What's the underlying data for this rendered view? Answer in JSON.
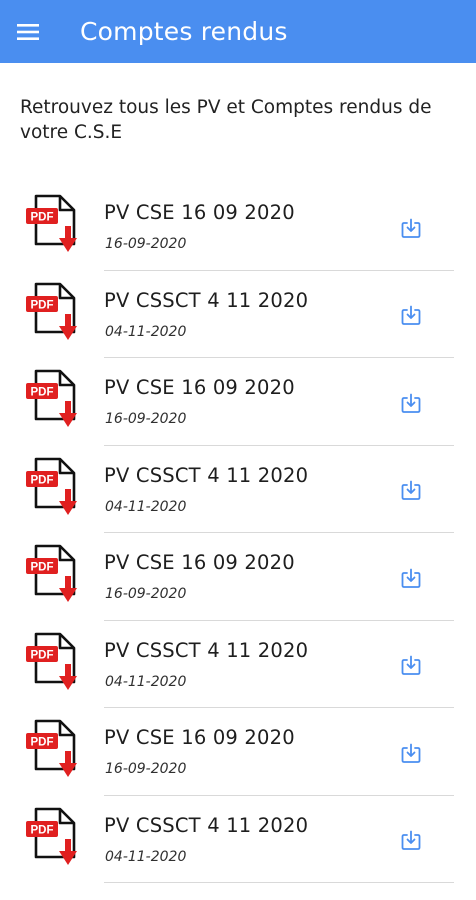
{
  "appbar": {
    "title": "Comptes rendus",
    "menu_icon": "hamburger-menu-icon",
    "color": "#4a8ef0"
  },
  "intro": "Retrouvez tous les PV et Comptes rendus de votre C.S.E",
  "documents": [
    {
      "title": "PV CSE 16 09 2020",
      "date": "16-09-2020",
      "file_icon": "pdf-file-icon",
      "action_icon": "download-icon"
    },
    {
      "title": "PV CSSCT 4 11 2020",
      "date": "04-11-2020",
      "file_icon": "pdf-file-icon",
      "action_icon": "download-icon"
    },
    {
      "title": "PV CSE 16 09 2020",
      "date": "16-09-2020",
      "file_icon": "pdf-file-icon",
      "action_icon": "download-icon"
    },
    {
      "title": "PV CSSCT 4 11 2020",
      "date": "04-11-2020",
      "file_icon": "pdf-file-icon",
      "action_icon": "download-icon"
    },
    {
      "title": "PV CSE 16 09 2020",
      "date": "16-09-2020",
      "file_icon": "pdf-file-icon",
      "action_icon": "download-icon"
    },
    {
      "title": "PV CSSCT 4 11 2020",
      "date": "04-11-2020",
      "file_icon": "pdf-file-icon",
      "action_icon": "download-icon"
    },
    {
      "title": "PV CSE 16 09 2020",
      "date": "16-09-2020",
      "file_icon": "pdf-file-icon",
      "action_icon": "download-icon"
    },
    {
      "title": "PV CSSCT 4 11 2020",
      "date": "04-11-2020",
      "file_icon": "pdf-file-icon",
      "action_icon": "download-icon"
    }
  ],
  "pdf_label": "PDF",
  "colors": {
    "pdf_red": "#e02020",
    "download_blue": "#4a8ef0",
    "divider": "#d9d9d9"
  }
}
